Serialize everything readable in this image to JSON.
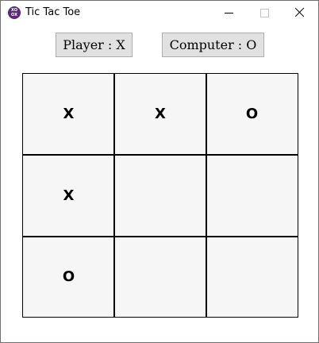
{
  "window": {
    "title": "Tic Tac Toe",
    "icon": "tic-tac-toe-app-icon",
    "icon_text_top": "XO",
    "icon_text_bottom": "OX",
    "controls": [
      "minimize",
      "maximize",
      "close"
    ]
  },
  "scoreboard": {
    "player_label": "Player : X",
    "computer_label": "Computer : O"
  },
  "board": {
    "cells": [
      [
        "X",
        "X",
        "O"
      ],
      [
        "X",
        "",
        ""
      ],
      [
        "O",
        "",
        ""
      ]
    ]
  },
  "colors": {
    "board_background": "#f6f6f6",
    "grid_line": "#000000",
    "button_face": "#e1e1e1",
    "app_icon": "#5a2a78"
  }
}
